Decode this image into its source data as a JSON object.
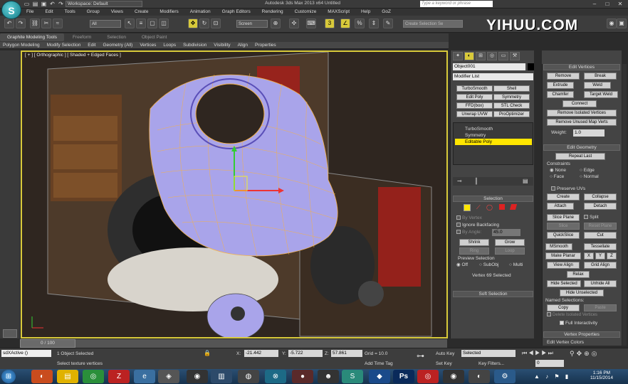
{
  "app": {
    "title": "Autodesk 3ds Max 2013 x64   Untitled",
    "workspace": "Workspace: Default",
    "search_placeholder": "Type a keyword or phrase",
    "logo_text": "YIHUU.COM"
  },
  "menu": [
    "File",
    "Edit",
    "Tools",
    "Group",
    "Views",
    "Create",
    "Modifiers",
    "Animation",
    "Graph Editors",
    "Rendering",
    "Customize",
    "MAXScript",
    "Help",
    "GoZ"
  ],
  "toolbar": {
    "select_filter": "All",
    "ref_coord": "Screen",
    "selection_set_placeholder": "Create Selection Se"
  },
  "ribbon": {
    "tabs": [
      "Graphite Modeling Tools",
      "Freeform",
      "Selection",
      "Object Paint"
    ],
    "panels": [
      "Polygon Modeling",
      "Modify Selection",
      "Edit",
      "Geometry (All)",
      "Vertices",
      "Loops",
      "Subdivision",
      "Visibility",
      "Align",
      "Properties"
    ]
  },
  "viewport": {
    "label": "[ + ] [ Orthographic ] [ Shaded + Edged Faces ]"
  },
  "command_panel": {
    "object_name": "Object001",
    "modifier_list": "Modifier List",
    "mod_buttons": [
      "TurboSmooth",
      "Shell",
      "Edit Poly",
      "Symmetry",
      "FFD(box)",
      "STL Check",
      "Unwrap UVW",
      "ProOptimizer"
    ],
    "stack": [
      "TurboSmooth",
      "Symmetry",
      "Editable Poly"
    ],
    "selection": {
      "header": "Selection",
      "by_vertex": "By Vertex",
      "ignore_backfacing": "Ignore Backfacing",
      "by_angle": "By Angle:",
      "angle_value": "45.0",
      "shrink": "Shrink",
      "grow": "Grow",
      "ring": "Ring",
      "loop": "Loop",
      "preview_selection": "Preview Selection",
      "off": "Off",
      "subobj": "SubObj",
      "multi": "Multi",
      "status": "Vertex 69 Selected"
    },
    "soft_selection": "Soft Selection"
  },
  "edit_vertices": {
    "header": "Edit Vertices",
    "buttons": [
      "Remove",
      "Break",
      "Extrude",
      "Weld",
      "Chamfer",
      "Target Weld"
    ],
    "connect": "Connect",
    "remove_isolated": "Remove Isolated Vertices",
    "remove_unused": "Remove Unused Map Verts",
    "weight_label": "Weight:",
    "weight_value": "1.0"
  },
  "edit_geometry": {
    "header": "Edit Geometry",
    "repeat_last": "Repeat Last",
    "constraints": "Constraints",
    "none": "None",
    "edge": "Edge",
    "face": "Face",
    "normal": "Normal",
    "preserve_uvs": "Preserve UVs",
    "create": "Create",
    "collapse": "Collapse",
    "attach": "Attach",
    "detach": "Detach",
    "slice_plane": "Slice Plane",
    "split": "Split",
    "slice": "Slice",
    "reset_plane": "Reset Plane",
    "quickslice": "QuickSlice",
    "cut": "Cut",
    "msmooth": "MSmooth",
    "tessellate": "Tessellate",
    "make_planar": "Make Planar",
    "x": "X",
    "y": "Y",
    "z": "Z",
    "view_align": "View Align",
    "grid_align": "Grid Align",
    "relax": "Relax",
    "hide_selected": "Hide Selected",
    "unhide_all": "Unhide All",
    "hide_unselected": "Hide Unselected",
    "named_selections": "Named Selections:",
    "copy": "Copy",
    "paste": "Paste",
    "delete_isolated": "Delete Isolated Vertices",
    "full_interactivity": "Full Interactivity"
  },
  "vertex_properties": {
    "header": "Vertex Properties",
    "edit_colors": "Edit Vertex Colors"
  },
  "timeline": {
    "frame": "0 / 100"
  },
  "status": {
    "objects": "1 Object Selected",
    "prompt": "Select texture vertices",
    "maxscript": "sdXActive ()",
    "x": "-21.442",
    "y": "-5.722",
    "z": "57.861",
    "grid": "Grid = 10.0",
    "add_time_tag": "Add Time Tag",
    "auto_key": "Auto Key",
    "set_key": "Set Key",
    "key_mode": "Selected",
    "key_filters": "Key Filters...",
    "frame_value": "0",
    "X_label": "X:",
    "Y_label": "Y:",
    "Z_label": "Z:"
  },
  "clock": {
    "time": "1:16 PM",
    "date": "11/15/2014"
  },
  "colors": {
    "accent": "#d8c93a",
    "mesh": "#a9a4ea",
    "edge": "#f4b24a",
    "selection": "#ffe600"
  }
}
